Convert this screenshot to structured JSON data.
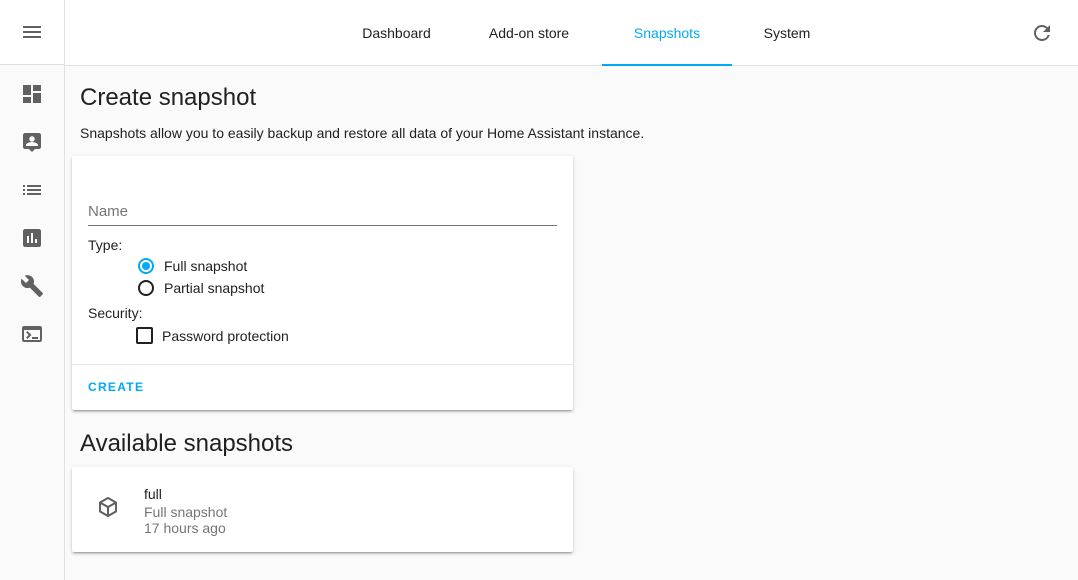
{
  "header": {
    "tabs": [
      {
        "label": "Dashboard"
      },
      {
        "label": "Add-on store"
      },
      {
        "label": "Snapshots"
      },
      {
        "label": "System"
      }
    ],
    "active_tab": "Snapshots"
  },
  "sidebar": {
    "items": [
      {
        "icon": "dashboard-icon"
      },
      {
        "icon": "account-box-icon"
      },
      {
        "icon": "list-icon"
      },
      {
        "icon": "chart-icon"
      },
      {
        "icon": "wrench-icon"
      },
      {
        "icon": "console-icon"
      }
    ]
  },
  "create": {
    "title": "Create snapshot",
    "description": "Snapshots allow you to easily backup and restore all data of your Home Assistant instance.",
    "name_placeholder": "Name",
    "name_value": "",
    "type_label": "Type:",
    "type_options": [
      "Full snapshot",
      "Partial snapshot"
    ],
    "type_selected": "Full snapshot",
    "security_label": "Security:",
    "password_label": "Password protection",
    "password_checked": false,
    "create_button": "CREATE"
  },
  "available": {
    "title": "Available snapshots",
    "snapshots": [
      {
        "name": "full",
        "type": "Full snapshot",
        "time": "17 hours ago"
      }
    ]
  },
  "colors": {
    "accent": "#03a9f4",
    "text": "#212121",
    "secondary_text": "#757575",
    "background": "#fafafa"
  }
}
